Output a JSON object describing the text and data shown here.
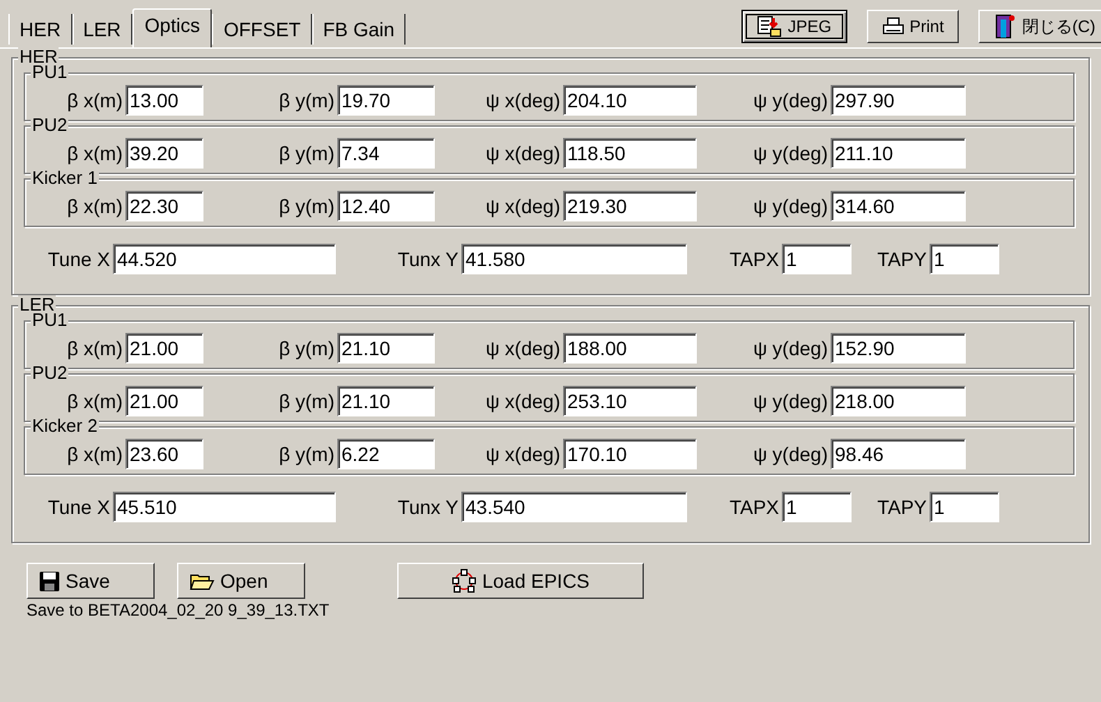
{
  "tabs": [
    {
      "label": "HER",
      "selected": false
    },
    {
      "label": "LER",
      "selected": false
    },
    {
      "label": "Optics",
      "selected": true
    },
    {
      "label": "OFFSET",
      "selected": false
    },
    {
      "label": "FB Gain",
      "selected": false
    }
  ],
  "toolbar_buttons": [
    {
      "label": "JPEG",
      "kind": "jpeg",
      "focused": true
    },
    {
      "label": "Print",
      "kind": "print",
      "focused": false
    },
    {
      "label": "閉じる(C)",
      "kind": "close",
      "focused": false
    }
  ],
  "groups": [
    {
      "title": "HER",
      "sections": [
        {
          "title": "PU1",
          "fields": [
            {
              "label": "β x(m)",
              "value": "13.00"
            },
            {
              "label": "β y(m)",
              "value": "19.70"
            },
            {
              "label": "ψ x(deg)",
              "value": "204.10"
            },
            {
              "label": "ψ y(deg)",
              "value": "297.90"
            }
          ]
        },
        {
          "title": "PU2",
          "fields": [
            {
              "label": "β x(m)",
              "value": "39.20"
            },
            {
              "label": "β y(m)",
              "value": "7.34"
            },
            {
              "label": "ψ x(deg)",
              "value": "118.50"
            },
            {
              "label": "ψ y(deg)",
              "value": "211.10"
            }
          ]
        },
        {
          "title": "Kicker 1",
          "fields": [
            {
              "label": "β x(m)",
              "value": "22.30"
            },
            {
              "label": "β y(m)",
              "value": "12.40"
            },
            {
              "label": "ψ x(deg)",
              "value": "219.30"
            },
            {
              "label": "ψ y(deg)",
              "value": "314.60"
            }
          ]
        }
      ],
      "tune_fields": [
        {
          "label": "Tune X",
          "value": "44.520"
        },
        {
          "label": "Tunx Y",
          "value": "41.580"
        },
        {
          "label": "TAPX",
          "value": "1"
        },
        {
          "label": "TAPY",
          "value": "1"
        }
      ]
    },
    {
      "title": "LER",
      "sections": [
        {
          "title": "PU1",
          "fields": [
            {
              "label": "β x(m)",
              "value": "21.00"
            },
            {
              "label": "β y(m)",
              "value": "21.10"
            },
            {
              "label": "ψ x(deg)",
              "value": "188.00"
            },
            {
              "label": "ψ y(deg)",
              "value": "152.90"
            }
          ]
        },
        {
          "title": "PU2",
          "fields": [
            {
              "label": "β x(m)",
              "value": "21.00"
            },
            {
              "label": "β y(m)",
              "value": "21.10"
            },
            {
              "label": "ψ x(deg)",
              "value": "253.10"
            },
            {
              "label": "ψ y(deg)",
              "value": "218.00"
            }
          ]
        },
        {
          "title": "Kicker 2",
          "fields": [
            {
              "label": "β x(m)",
              "value": "23.60"
            },
            {
              "label": "β y(m)",
              "value": "6.22"
            },
            {
              "label": "ψ x(deg)",
              "value": "170.10"
            },
            {
              "label": "ψ y(deg)",
              "value": "98.46"
            }
          ]
        }
      ],
      "tune_fields": [
        {
          "label": "Tune X",
          "value": "45.510"
        },
        {
          "label": "Tunx Y",
          "value": "43.540"
        },
        {
          "label": "TAPX",
          "value": "1"
        },
        {
          "label": "TAPY",
          "value": "1"
        }
      ]
    }
  ],
  "bottom_buttons": [
    {
      "label": "Save",
      "kind": "save"
    },
    {
      "label": "Open",
      "kind": "open"
    },
    {
      "label": "Load EPICS",
      "kind": "epics"
    }
  ],
  "status": "Save to BETA2004_02_20 9_39_13.TXT"
}
